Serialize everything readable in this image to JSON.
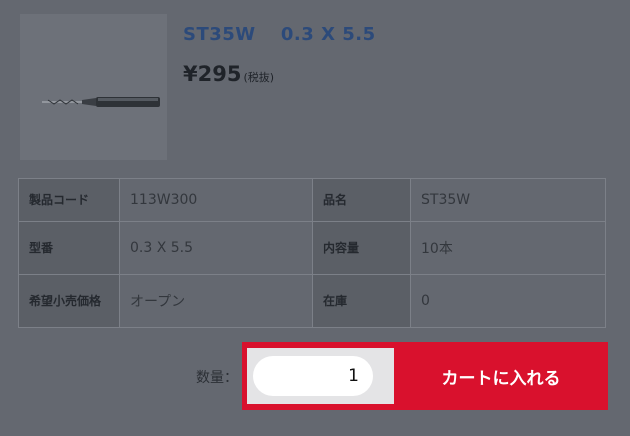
{
  "product": {
    "name": "ST35W　 0.3 X 5.5",
    "price": "¥295",
    "tax_note": "(税抜)",
    "image_icon": "drill-bit-icon"
  },
  "specs": [
    {
      "label": "製品コード",
      "value": "113W300",
      "label2": "品名",
      "value2": "ST35W"
    },
    {
      "label": "型番",
      "value": "0.3 X 5.5",
      "label2": "内容量",
      "value2": "10本"
    },
    {
      "label": "希望小売価格",
      "value": "オープン",
      "label2": "在庫",
      "value2": "0"
    }
  ],
  "cart": {
    "quantity_label": "数量：",
    "quantity_value": "1",
    "add_button": "カートに入れる"
  },
  "colors": {
    "accent": "#d9112d",
    "product_name": "#2c4a7a"
  }
}
